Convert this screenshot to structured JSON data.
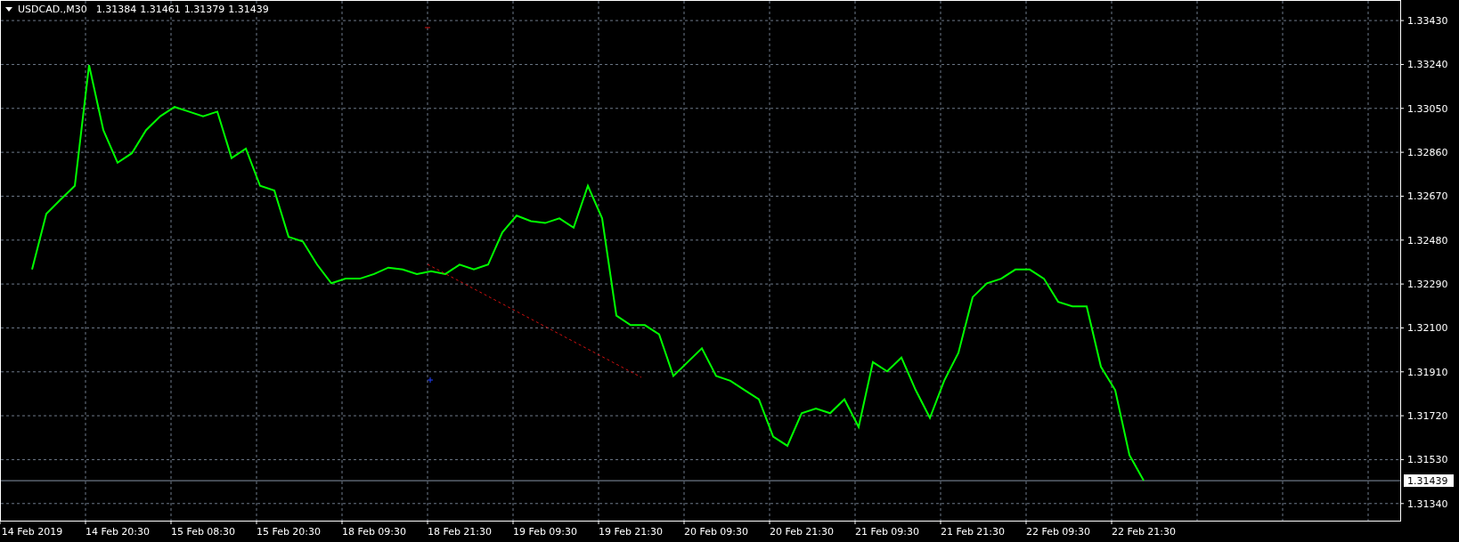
{
  "header": {
    "symbol": "USDCAD.,M30",
    "quotes": [
      "1.31384",
      "1.31461",
      "1.31379",
      "1.31439"
    ]
  },
  "chart_data": {
    "type": "line",
    "grid": true,
    "ylim": [
      1.31266,
      1.33519
    ],
    "categories": [
      "14 Feb 2019",
      null,
      null,
      null,
      null,
      null,
      "14 Feb 20:30",
      null,
      null,
      null,
      null,
      null,
      "15 Feb 08:30",
      null,
      null,
      null,
      null,
      null,
      "15 Feb 20:30",
      null,
      null,
      null,
      null,
      null,
      "18 Feb 09:30",
      null,
      null,
      null,
      null,
      null,
      "18 Feb 21:30",
      null,
      null,
      null,
      null,
      null,
      "19 Feb 09:30",
      null,
      null,
      null,
      null,
      null,
      "19 Feb 21:30",
      null,
      null,
      null,
      null,
      null,
      "20 Feb 09:30",
      null,
      null,
      null,
      null,
      null,
      "20 Feb 21:30",
      null,
      null,
      null,
      null,
      null,
      "21 Feb 09:30",
      null,
      null,
      null,
      null,
      null,
      "21 Feb 21:30",
      null,
      null,
      null,
      null,
      null,
      "22 Feb 09:30",
      null,
      null,
      null,
      null,
      null,
      "22 Feb 21:30"
    ],
    "yticks": [
      {
        "value": 1.3343,
        "label": "1.33430"
      },
      {
        "value": 1.3324,
        "label": "1.33240"
      },
      {
        "value": 1.3305,
        "label": "1.33050"
      },
      {
        "value": 1.3286,
        "label": "1.32860"
      },
      {
        "value": 1.3267,
        "label": "1.32670"
      },
      {
        "value": 1.3248,
        "label": "1.32480"
      },
      {
        "value": 1.3229,
        "label": "1.32290"
      },
      {
        "value": 1.321,
        "label": "1.32100"
      },
      {
        "value": 1.3191,
        "label": "1.31910"
      },
      {
        "value": 1.3172,
        "label": "1.31720"
      },
      {
        "value": 1.3153,
        "label": "1.31530"
      },
      {
        "value": 1.3134,
        "label": "1.31340"
      }
    ],
    "series": [
      {
        "color": "#00ff00",
        "values": [
          1.32353,
          1.32594,
          1.32655,
          1.32715,
          1.33237,
          1.32956,
          1.32815,
          1.32856,
          1.32956,
          1.33016,
          1.33056,
          1.33036,
          1.33016,
          1.33036,
          1.32835,
          1.32876,
          1.32715,
          1.32695,
          1.32494,
          1.32474,
          1.32374,
          1.32293,
          1.32313,
          1.32313,
          1.32333,
          1.32361,
          1.32353,
          1.32333,
          1.32345,
          1.32333,
          1.32374,
          1.32353,
          1.32374,
          1.32514,
          1.32586,
          1.32562,
          1.32554,
          1.32574,
          1.32534,
          1.32715,
          1.32574,
          1.32153,
          1.32112,
          1.32112,
          1.32072,
          1.31892,
          1.31952,
          1.32012,
          1.31892,
          1.31871,
          1.31831,
          1.31791,
          1.3163,
          1.3159,
          1.31731,
          1.31751,
          1.31731,
          1.31791,
          1.31671,
          1.31952,
          1.31912,
          1.31972,
          1.31831,
          1.31711,
          1.31871,
          1.31992,
          1.32233,
          1.32293,
          1.32313,
          1.32353,
          1.32353,
          1.32313,
          1.32213,
          1.32193,
          1.32193,
          1.31932,
          1.31831,
          1.3155,
          1.31439
        ]
      }
    ],
    "ref_lines": [
      {
        "axis": "y",
        "value": 1.31439,
        "label": "1.31439",
        "color": "#8795a8"
      }
    ]
  }
}
